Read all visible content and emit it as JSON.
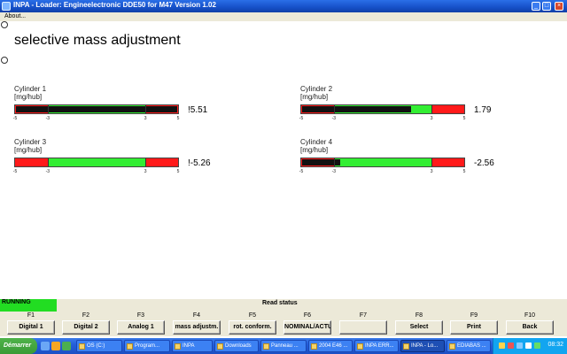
{
  "window": {
    "title": "INPA - Loader:  Engineelectronic DDE50 for M47 Version 1.02",
    "menu": [
      "About..."
    ]
  },
  "screen": {
    "title": "selective mass adjustment"
  },
  "gauges": [
    {
      "name": "Cylinder 1",
      "unit": "[mg/hub]",
      "value": "!5.51",
      "range": [
        -5,
        5
      ],
      "green_range": [
        -3,
        3
      ],
      "indicator_range": [
        -5,
        5.51
      ],
      "ticks": [
        "-5",
        "-3",
        "3",
        "5"
      ]
    },
    {
      "name": "Cylinder 2",
      "unit": "[mg/hub]",
      "value": "1.79",
      "range": [
        -5,
        5
      ],
      "green_range": [
        -3,
        3
      ],
      "indicator_range": [
        -5,
        1.79
      ],
      "ticks": [
        "-5",
        "-3",
        "3",
        "5"
      ]
    },
    {
      "name": "Cylinder 3",
      "unit": "[mg/hub]",
      "value": "!-5.26",
      "range": [
        -5,
        5
      ],
      "green_range": [
        -3,
        3
      ],
      "indicator_range": null,
      "ticks": [
        "-5",
        "-3",
        "3",
        "5"
      ]
    },
    {
      "name": "Cylinder 4",
      "unit": "[mg/hub]",
      "value": "-2.56",
      "range": [
        -5,
        5
      ],
      "green_range": [
        -3,
        3
      ],
      "indicator_range": [
        -5,
        -2.56
      ],
      "ticks": [
        "-5",
        "-3",
        "3",
        "5"
      ]
    }
  ],
  "status": {
    "state": "RUNNING",
    "text": "Read status"
  },
  "function_keys": [
    {
      "key": "F1",
      "label": "Digital 1"
    },
    {
      "key": "F2",
      "label": "Digital 2"
    },
    {
      "key": "F3",
      "label": "Analog 1"
    },
    {
      "key": "F4",
      "label": "mass adjustm."
    },
    {
      "key": "F5",
      "label": "rot. conform."
    },
    {
      "key": "F6",
      "label": "NOMINAL/ACTUAL"
    },
    {
      "key": "F7",
      "label": ""
    },
    {
      "key": "F8",
      "label": "Select"
    },
    {
      "key": "F9",
      "label": "Print"
    },
    {
      "key": "F10",
      "label": "Back"
    }
  ],
  "taskbar": {
    "start": "Démarrer",
    "tasks": [
      "OS (C:)",
      "Program...",
      "INPA",
      "Downloads",
      "Panneau ...",
      "2004 E46 ...",
      "INPA ERR...",
      "INPA - Lo...",
      "EDIABAS ..."
    ],
    "active_task": "INPA - Lo...",
    "clock": "08:32"
  },
  "colors": {
    "titlebar": "#1650c8",
    "gauge_red": "#ff1a1a",
    "gauge_green": "#33ee33",
    "indicator": "#111111",
    "status_running": "#22dd22"
  }
}
